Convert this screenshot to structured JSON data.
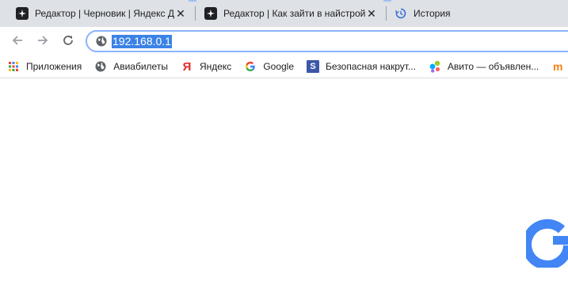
{
  "tabs": [
    {
      "title": "Редактор | Черновик | Яндекс Д",
      "icon": "star-sparkle-icon",
      "close": "✕"
    },
    {
      "title": "Редактор | Как зайти в найстрой",
      "icon": "star-sparkle-icon",
      "close": "✕"
    },
    {
      "title": "История",
      "icon": "history-icon"
    }
  ],
  "omnibox": {
    "url": "192.168.0.1"
  },
  "bookmarks": [
    {
      "label": "Приложения",
      "icon": "apps-grid-icon"
    },
    {
      "label": "Авиабилеты",
      "icon": "globe-icon"
    },
    {
      "label": "Яндекс",
      "icon": "yandex-icon",
      "glyph": "Я"
    },
    {
      "label": "Google",
      "icon": "google-icon"
    },
    {
      "label": "Безопасная накрут...",
      "icon": "s-badge-icon",
      "glyph": "S"
    },
    {
      "label": "Авито — объявлен...",
      "icon": "avito-icon"
    },
    {
      "label": "",
      "icon": "moodle-icon",
      "glyph": "m"
    }
  ],
  "colors": {
    "tab_strip": "#dee1e6",
    "accent_blue": "#3b82e6",
    "focus_ring": "#8ab4f8",
    "yandex_red": "#e42c2c",
    "google_blue": "#4285f4"
  }
}
